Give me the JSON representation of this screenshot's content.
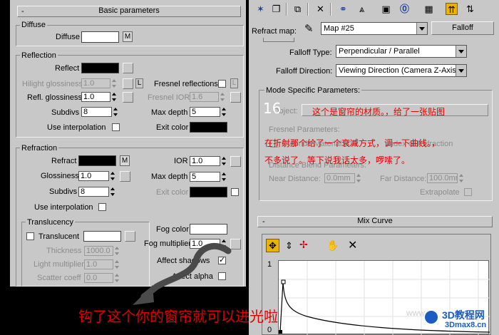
{
  "left_panel": {
    "rollout_title": "Basic parameters",
    "rollout_sign": "-",
    "diffuse": {
      "group": "Diffuse",
      "label": "Diffuse",
      "map_button": "M"
    },
    "reflection": {
      "group": "Reflection",
      "reflect_label": "Reflect",
      "hilight_label": "Hilight glossiness",
      "hilight_value": "1.0",
      "lock_label": "L",
      "fresnel_label": "Fresnel reflections",
      "fresnel_lock": "L",
      "refl_gloss_label": "Refl. glossiness",
      "refl_gloss_value": "1.0",
      "fresnel_ior_label": "Fresnel IOR",
      "fresnel_ior_value": "1.6",
      "subdivs_label": "Subdivs",
      "subdivs_value": "8",
      "max_depth_label": "Max depth",
      "max_depth_value": "5",
      "use_interp_label": "Use interpolation",
      "exit_color_label": "Exit color"
    },
    "refraction": {
      "group": "Refraction",
      "refract_label": "Refract",
      "map_button": "M",
      "ior_label": "IOR",
      "ior_value": "1.0",
      "gloss_label": "Glossiness",
      "gloss_value": "1.0",
      "max_depth_label": "Max depth",
      "max_depth_value": "5",
      "subdivs_label": "Subdivs",
      "subdivs_value": "8",
      "exit_color_label": "Exit color",
      "use_interp_label": "Use interpolation",
      "translucency": {
        "group": "Translucency",
        "translucent_label": "Translucent",
        "thickness_label": "Thickness",
        "thickness_value": "1000.0",
        "light_mult_label": "Light multiplier",
        "light_mult_value": "1.0",
        "scatter_label": "Scatter coeff",
        "scatter_value": "0.0"
      },
      "fog_color_label": "Fog color",
      "fog_mult_label": "Fog multiplier",
      "fog_mult_value": "1.0",
      "affect_shadows_label": "Affect shadows",
      "affect_alpha_label": "Affect alpha"
    }
  },
  "right_panel": {
    "refract_map_label": "Refract map:",
    "map_name": "Map #25",
    "map_type_button": "Falloff",
    "falloff_type_label": "Falloff Type:",
    "falloff_type_value": "Perpendicular / Parallel",
    "falloff_direction_label": "Falloff Direction:",
    "falloff_direction_value": "Viewing Direction (Camera Z-Axis)",
    "mode_specific_group": "Mode Specific Parameters:",
    "object_label": "Object:",
    "fresnel_params_label": "Fresnel Parameters:",
    "override_ior_label": "Override Material IOR",
    "index_label": "Index of Refraction",
    "distance_blend_label": "Distance Blend Parameters:",
    "near_distance_label": "Near Distance:",
    "near_distance_value": "0.0mm",
    "far_distance_label": "Far Distance:",
    "far_distance_value": "100.0mm",
    "extrapolate_label": "Extrapolate",
    "mix_curve_title": "Mix Curve",
    "mix_curve_sign": "-",
    "curve_axis_top": "1",
    "curve_axis_bottom": "0"
  },
  "toolbar_icons": [
    "pick-icon",
    "camera-icon",
    "copy-icon",
    "delete-icon",
    "link-icon",
    "hierarchy-icon",
    "save-icon",
    "material-id-icon",
    "checker-icon",
    "nav-up-icon",
    "nav-side-icon"
  ],
  "annotations": {
    "number": "16",
    "line1": "这个是窗帘的材质。，给了一张贴图",
    "line2": "在折射那个给了一个衰减方式，调一下曲线。，",
    "line3": "不多说了。等下说我话太多，啰嗦了。",
    "bottom": "钩了这个你的窗帘就可以进光啦",
    "watermark_top": "3D教程网",
    "watermark_url": "3Dmax8.cn",
    "watermark_faint": "www"
  },
  "colors": {
    "panel": "#c8c8c8",
    "annotation_red": "#e00000",
    "annotation_number": "#ffffff",
    "watermark_blue": "#1a5bc4"
  }
}
